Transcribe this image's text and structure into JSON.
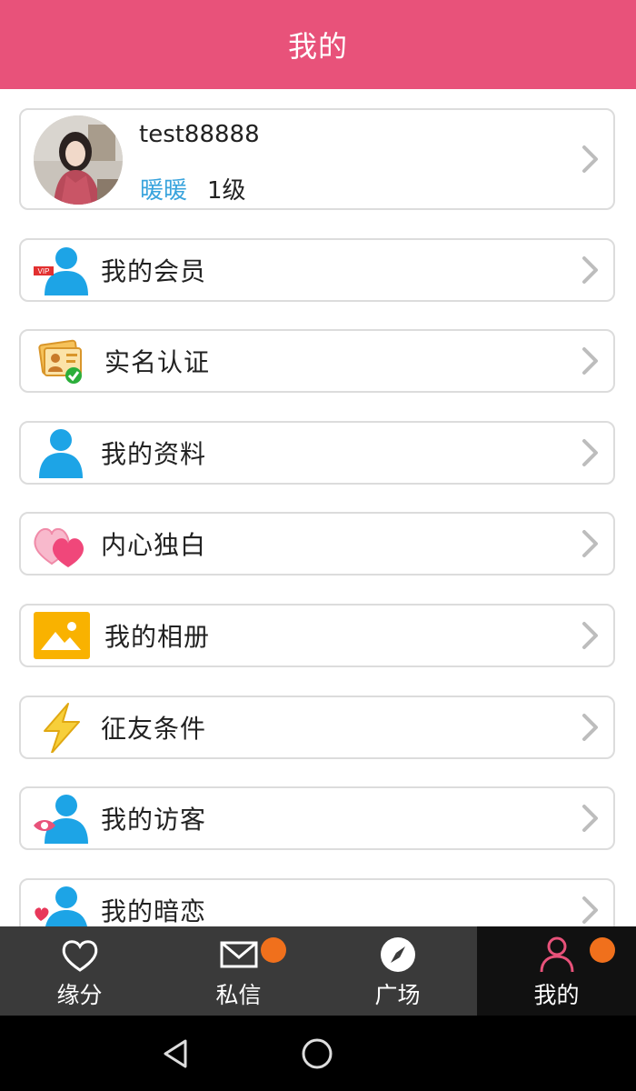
{
  "header": {
    "title": "我的"
  },
  "profile": {
    "username": "test88888",
    "nickname": "暖暖",
    "level": "1级"
  },
  "menu": [
    {
      "label": "我的会员",
      "icon": "vip-user-icon"
    },
    {
      "label": "实名认证",
      "icon": "id-verify-icon"
    },
    {
      "label": "我的资料",
      "icon": "user-profile-icon"
    },
    {
      "label": "内心独白",
      "icon": "hearts-icon"
    },
    {
      "label": "我的相册",
      "icon": "photo-album-icon"
    },
    {
      "label": "征友条件",
      "icon": "lightning-icon"
    },
    {
      "label": "我的访客",
      "icon": "visitor-eye-icon"
    },
    {
      "label": "我的暗恋",
      "icon": "crush-heart-icon"
    }
  ],
  "tabs": [
    {
      "label": "缘分",
      "icon": "heart-outline-icon",
      "badge": false,
      "active": false
    },
    {
      "label": "私信",
      "icon": "mail-icon",
      "badge": true,
      "active": false
    },
    {
      "label": "广场",
      "icon": "compass-icon",
      "badge": false,
      "active": false
    },
    {
      "label": "我的",
      "icon": "person-icon",
      "badge": true,
      "active": true
    }
  ],
  "colors": {
    "header": "#e8527a",
    "accent_blue": "#3aa4dd",
    "badge": "#f0701c",
    "tabbar": "#3a3a3a",
    "tab_active": "#111111"
  }
}
